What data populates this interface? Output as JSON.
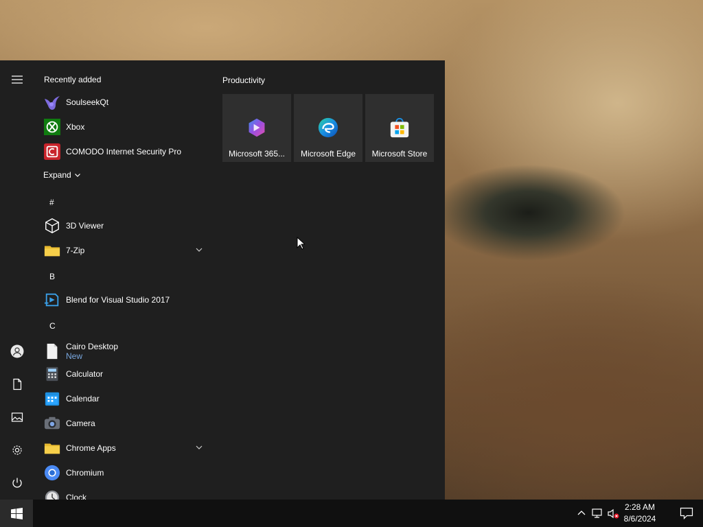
{
  "start_menu": {
    "recently_added_title": "Recently added",
    "recent_apps": [
      {
        "label": "SoulseekQt",
        "icon": "soulseek-bird-icon"
      },
      {
        "label": "Xbox",
        "icon": "xbox-icon"
      },
      {
        "label": "COMODO Internet Security Pro",
        "icon": "comodo-icon"
      }
    ],
    "expand_label": "Expand",
    "groups": [
      {
        "letter": "#",
        "apps": [
          {
            "label": "3D Viewer",
            "icon": "cube-icon"
          },
          {
            "label": "7-Zip",
            "icon": "folder-icon",
            "expandable": true
          }
        ]
      },
      {
        "letter": "B",
        "apps": [
          {
            "label": "Blend for Visual Studio 2017",
            "icon": "blend-icon"
          }
        ]
      },
      {
        "letter": "C",
        "apps": [
          {
            "label": "Cairo Desktop",
            "sub": "New",
            "icon": "document-icon"
          },
          {
            "label": "Calculator",
            "icon": "calculator-icon"
          },
          {
            "label": "Calendar",
            "icon": "calendar-icon"
          },
          {
            "label": "Camera",
            "icon": "camera-icon"
          },
          {
            "label": "Chrome Apps",
            "icon": "folder-icon",
            "expandable": true
          },
          {
            "label": "Chromium",
            "icon": "chromium-icon"
          },
          {
            "label": "Clock",
            "icon": "clock-icon"
          }
        ]
      }
    ],
    "tile_group_title": "Productivity",
    "tiles": [
      {
        "label": "Microsoft 365...",
        "icon": "microsoft-365-icon"
      },
      {
        "label": "Microsoft Edge",
        "icon": "edge-icon"
      },
      {
        "label": "Microsoft Store",
        "icon": "store-icon"
      }
    ]
  },
  "taskbar": {
    "time": "2:28 AM",
    "date": "8/6/2024"
  }
}
